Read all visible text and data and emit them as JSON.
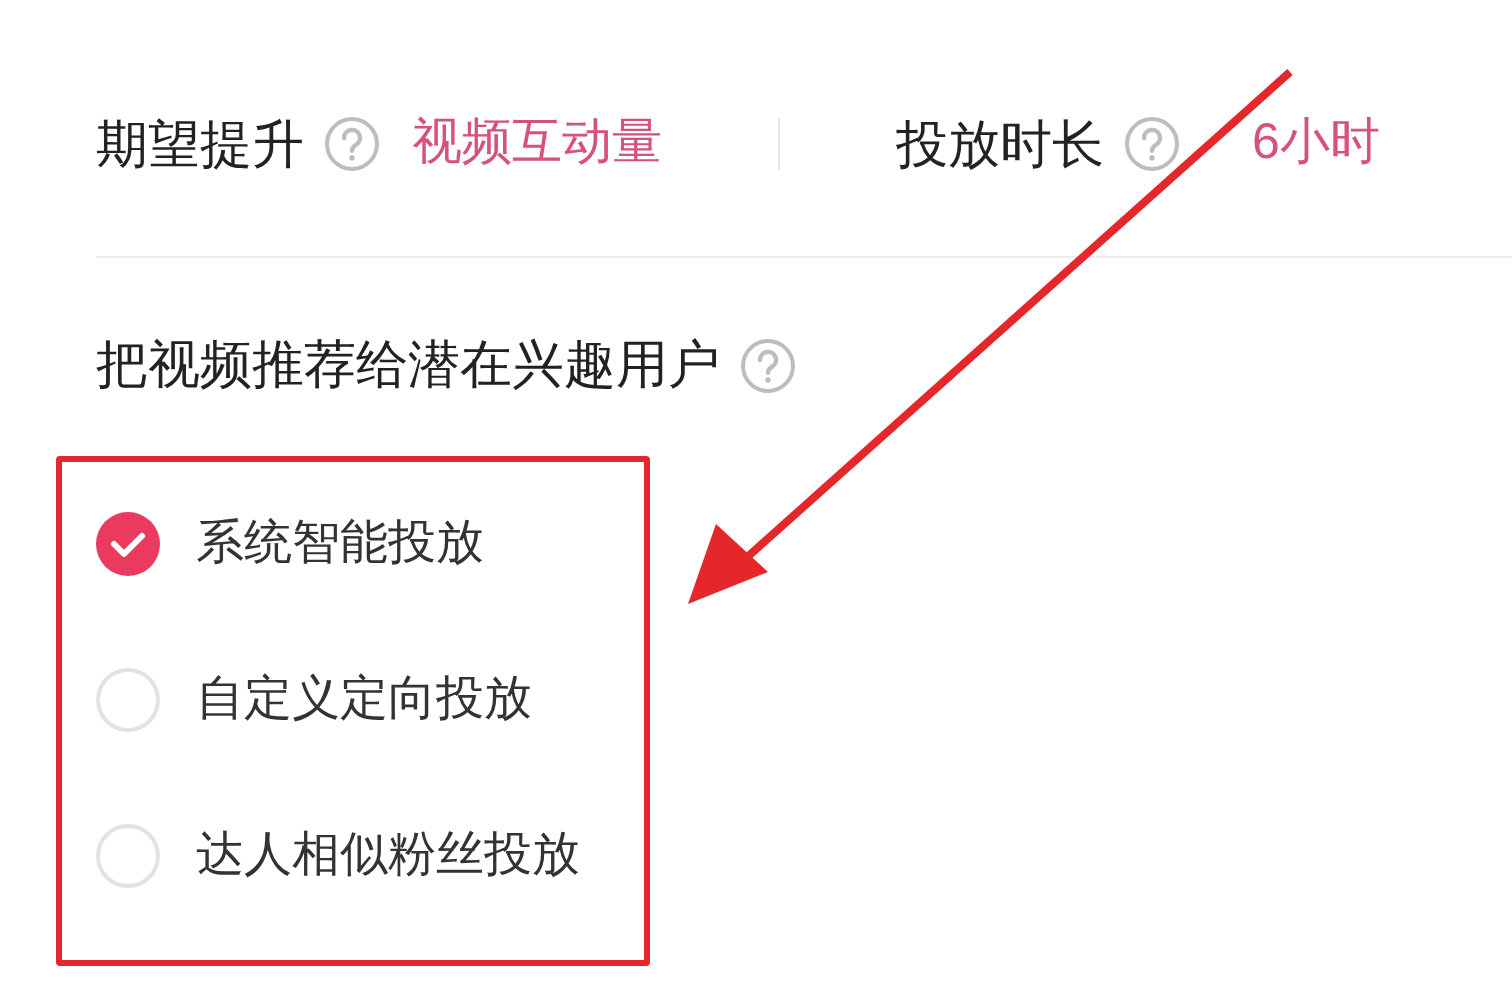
{
  "stats": [
    {
      "label": "期望提升",
      "value": "视频互动量"
    },
    {
      "label": "投放时长",
      "value": "6小时"
    }
  ],
  "question": {
    "label": "把视频推荐给潜在兴趣用户"
  },
  "options": [
    {
      "label": "系统智能投放",
      "selected": true
    },
    {
      "label": "自定义定向投放",
      "selected": false
    },
    {
      "label": "达人相似粉丝投放",
      "selected": false
    }
  ]
}
